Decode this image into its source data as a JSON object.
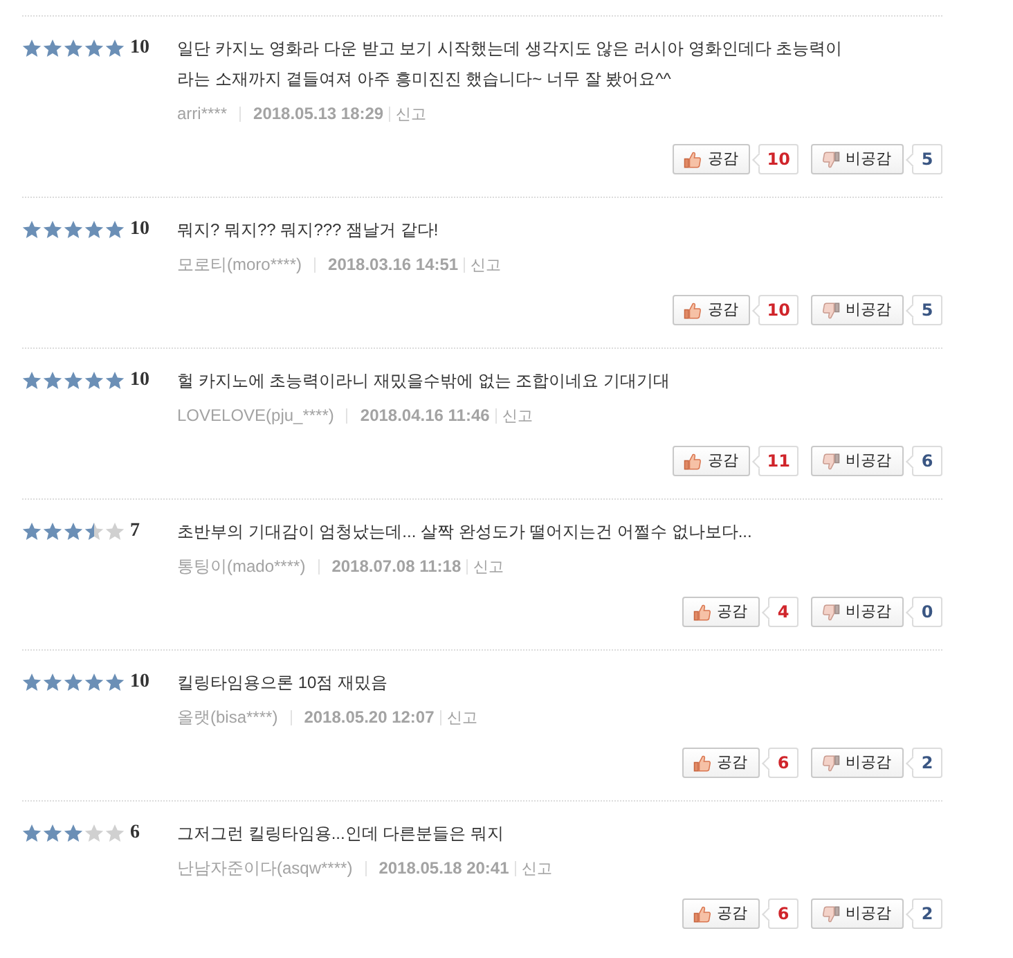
{
  "reviews": [
    {
      "stars": 5,
      "score": "10",
      "text": "일단 카지노 영화라 다운 받고 보기 시작했는데 생각지도 않은 러시아 영화인데다 초능력이라는 소재까지 곁들여져 아주 흥미진진 했습니다~ 너무 잘 봤어요^^",
      "author": "arri****",
      "date": "2018.05.13 18:29",
      "report": "신고",
      "like": {
        "label": "공감",
        "count": "10"
      },
      "dislike": {
        "label": "비공감",
        "count": "5"
      }
    },
    {
      "stars": 5,
      "score": "10",
      "text": "뭐지? 뭐지?? 뭐지??? 잼날거 같다!",
      "author": "모로티(moro****)",
      "date": "2018.03.16 14:51",
      "report": "신고",
      "like": {
        "label": "공감",
        "count": "10"
      },
      "dislike": {
        "label": "비공감",
        "count": "5"
      }
    },
    {
      "stars": 5,
      "score": "10",
      "text": "헐 카지노에 초능력이라니 재밌을수밖에 없는 조합이네요 기대기대",
      "author": "LOVELOVE(pju_****)",
      "date": "2018.04.16 11:46",
      "report": "신고",
      "like": {
        "label": "공감",
        "count": "11"
      },
      "dislike": {
        "label": "비공감",
        "count": "6"
      }
    },
    {
      "stars": 3.5,
      "score": "7",
      "text": "초반부의 기대감이 엄청났는데... 살짝 완성도가 떨어지는건 어쩔수 없나보다...",
      "author": "통팅이(mado****)",
      "date": "2018.07.08 11:18",
      "report": "신고",
      "like": {
        "label": "공감",
        "count": "4"
      },
      "dislike": {
        "label": "비공감",
        "count": "0"
      }
    },
    {
      "stars": 5,
      "score": "10",
      "text": "킬링타임용으론 10점 재밌음",
      "author": "올랫(bisa****)",
      "date": "2018.05.20 12:07",
      "report": "신고",
      "like": {
        "label": "공감",
        "count": "6"
      },
      "dislike": {
        "label": "비공감",
        "count": "2"
      }
    },
    {
      "stars": 3,
      "score": "6",
      "text": "그저그런 킬링타임용...인데 다른분들은 뭐지",
      "author": "난남자준이다(asqw****)",
      "date": "2018.05.18 20:41",
      "report": "신고",
      "like": {
        "label": "공감",
        "count": "6"
      },
      "dislike": {
        "label": "비공감",
        "count": "2"
      }
    }
  ]
}
